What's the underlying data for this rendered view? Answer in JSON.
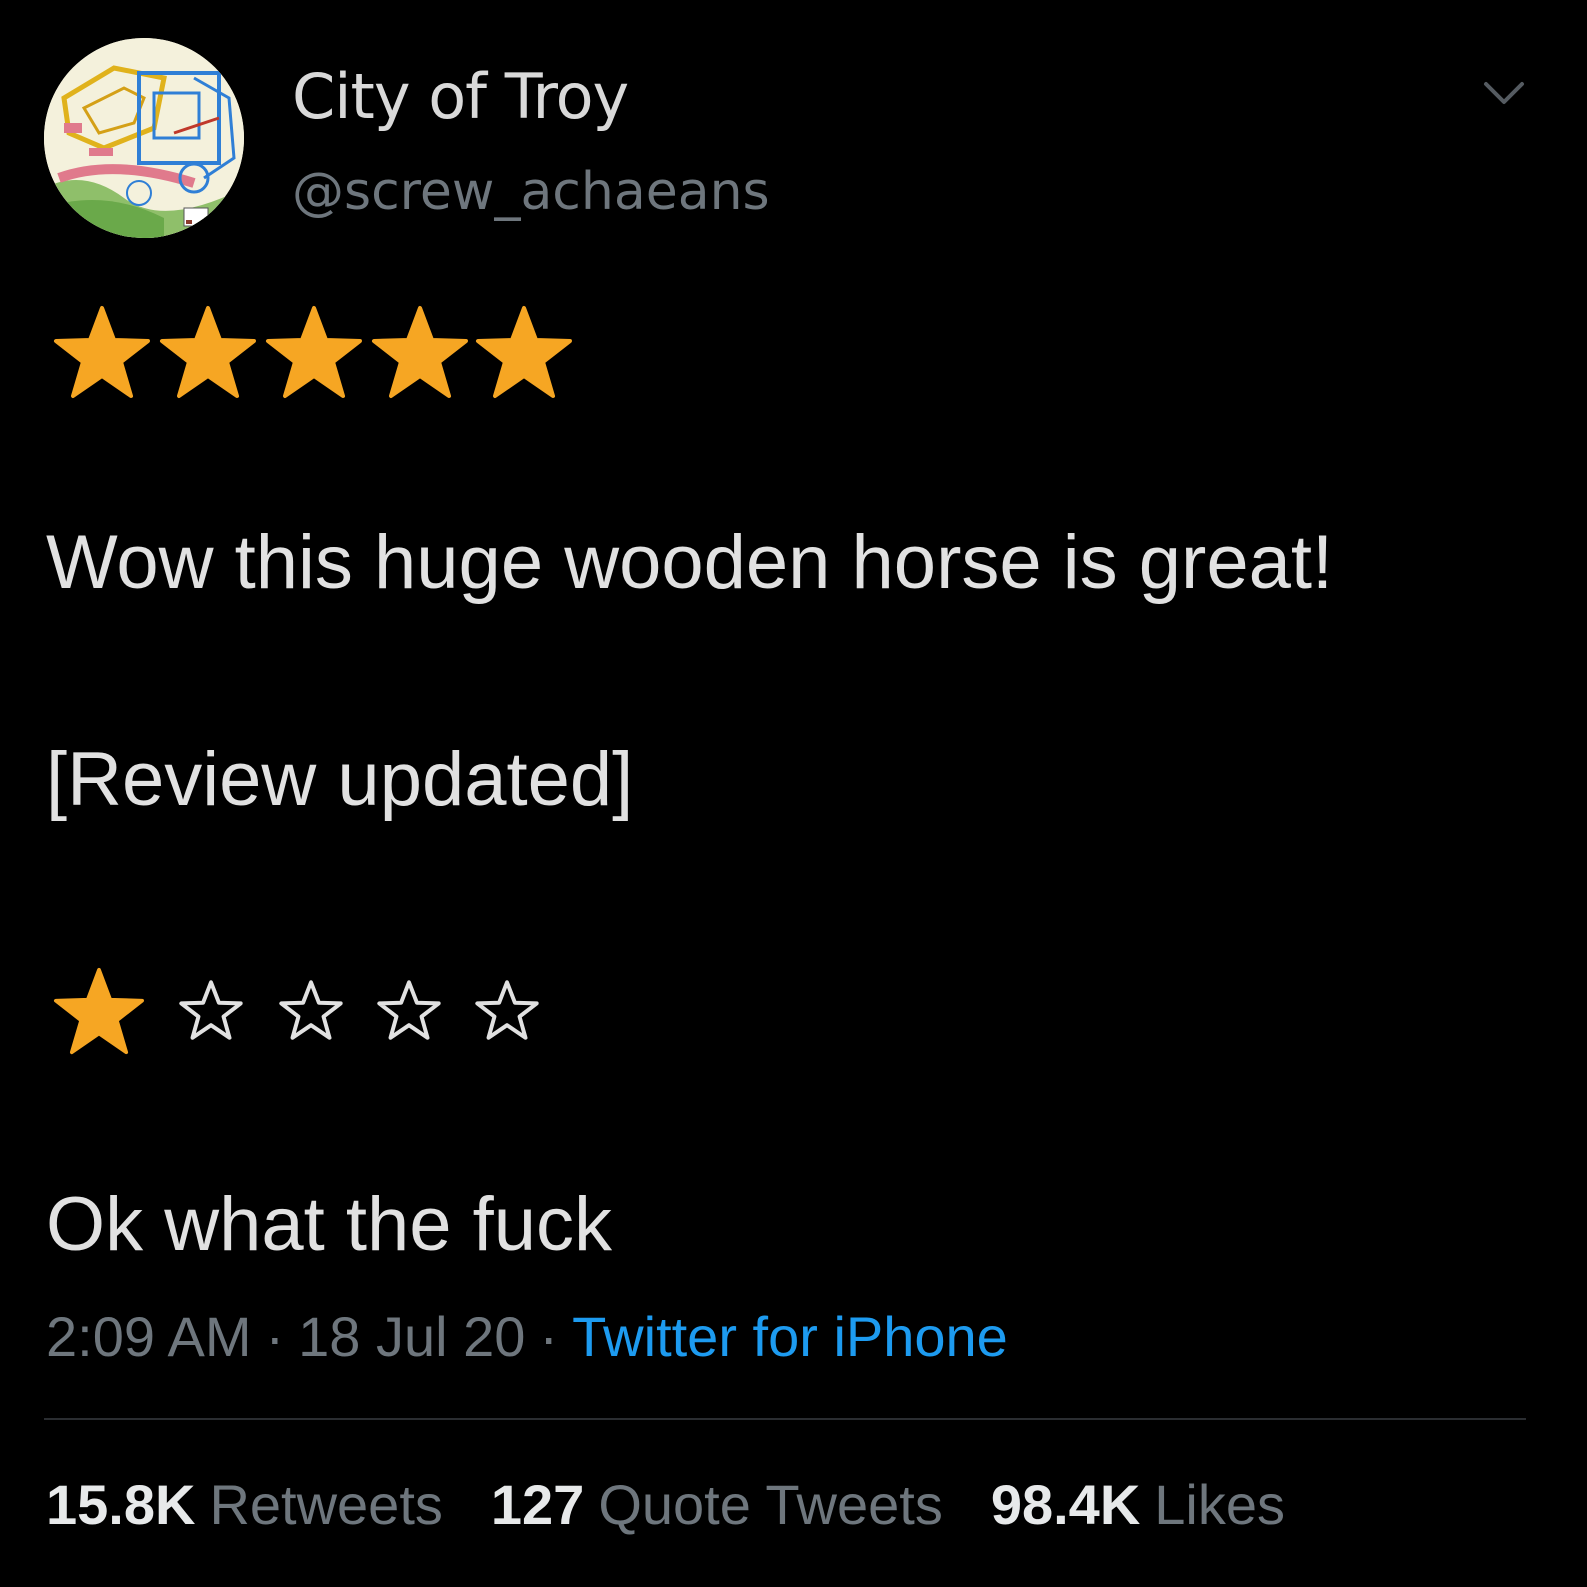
{
  "author": {
    "display_name": "City of Troy",
    "handle": "@screw_achaeans",
    "avatar_icon": "troy-site-map-avatar"
  },
  "rating_before": {
    "value": 5,
    "max": 5,
    "icon": "star-icon",
    "filled_color": "#f6a623"
  },
  "text": {
    "line1": "Wow this huge wooden horse is great!",
    "line2": "[Review updated]",
    "line3": "Ok what the fuck"
  },
  "rating_after": {
    "value": 1,
    "max": 5,
    "icon": "star-icon",
    "filled_color": "#f6a623",
    "empty_symbol": "☆"
  },
  "meta": {
    "time": "2:09 AM",
    "separator": "·",
    "date": "18 Jul 20",
    "source": "Twitter for iPhone",
    "source_color": "#1d9bf0"
  },
  "stats": {
    "retweets_count": "15.8K",
    "retweets_label": "Retweets",
    "quotes_count": "127",
    "quotes_label": "Quote Tweets",
    "likes_count": "98.4K",
    "likes_label": "Likes"
  }
}
